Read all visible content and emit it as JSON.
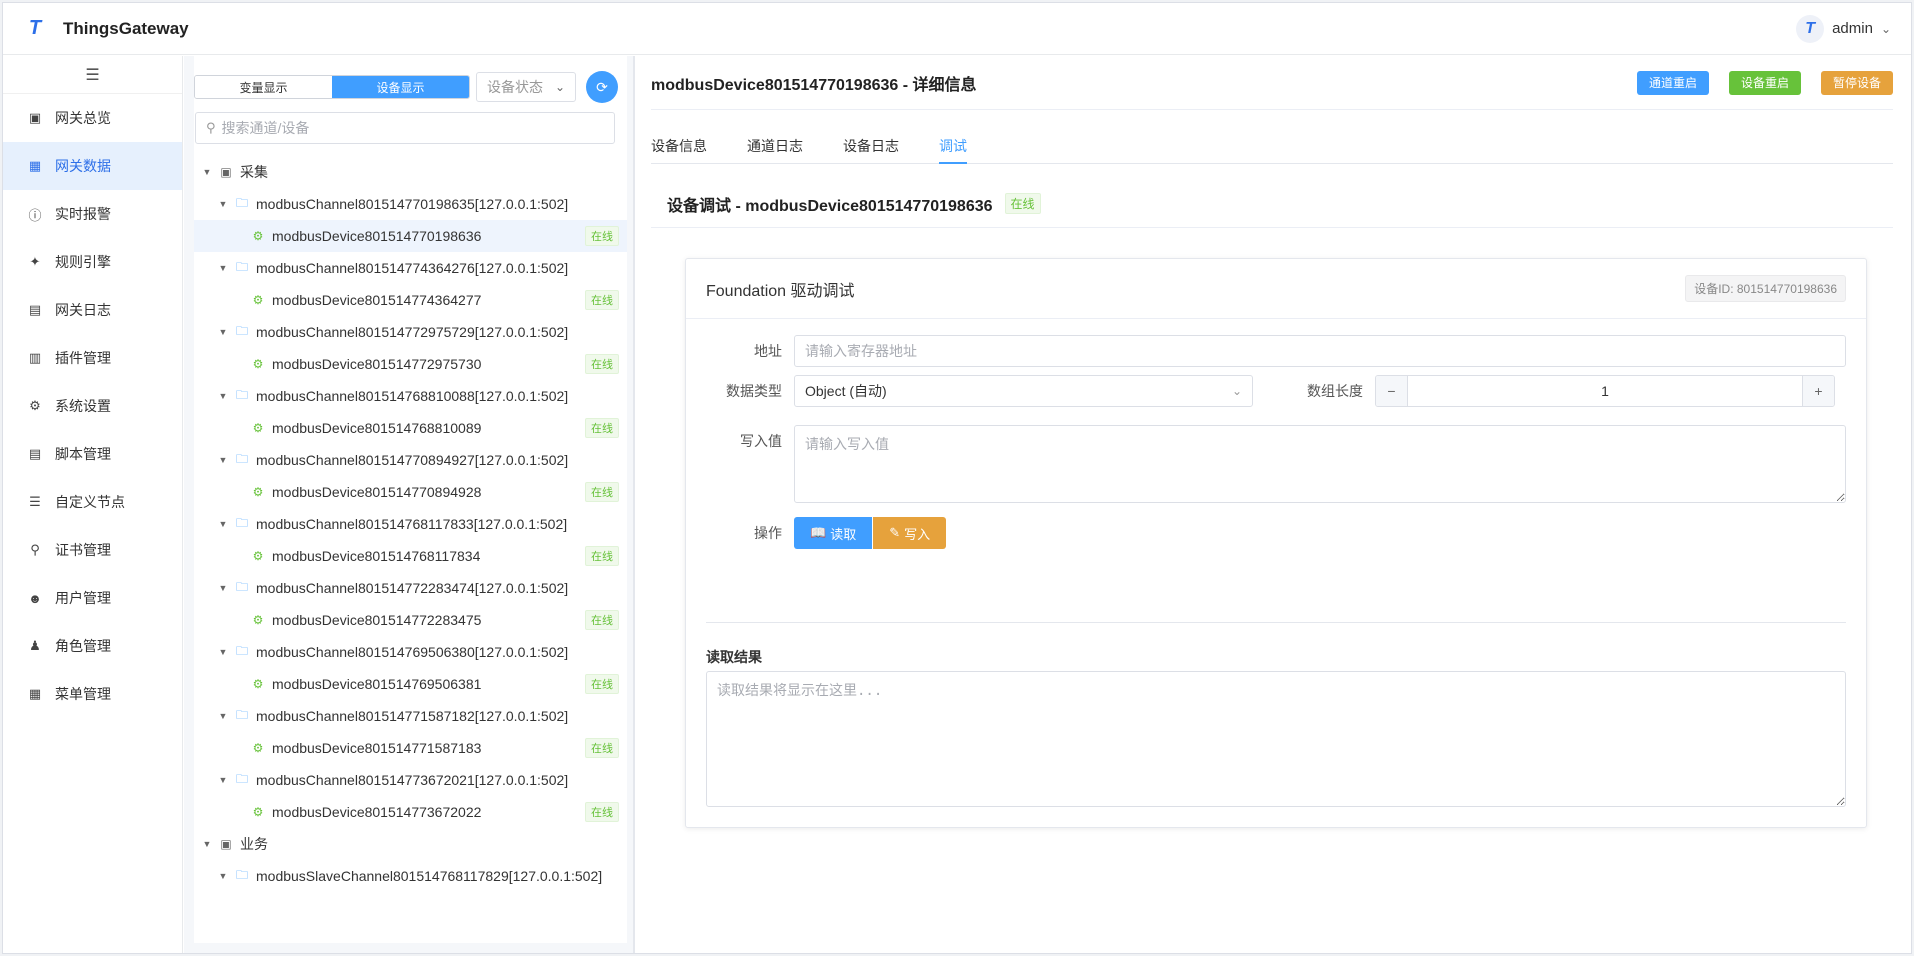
{
  "header": {
    "logo_letter": "T",
    "brand": "ThingsGateway",
    "avatar_letter": "T",
    "user": "admin"
  },
  "sidebar": {
    "items": [
      {
        "label": "网关总览",
        "icon": "monitor-icon"
      },
      {
        "label": "网关数据",
        "icon": "chart-icon"
      },
      {
        "label": "实时报警",
        "icon": "alert-icon"
      },
      {
        "label": "规则引擎",
        "icon": "share-icon"
      },
      {
        "label": "网关日志",
        "icon": "doc-icon"
      },
      {
        "label": "插件管理",
        "icon": "package-icon"
      },
      {
        "label": "系统设置",
        "icon": "gear-icon"
      },
      {
        "label": "脚本管理",
        "icon": "file-icon"
      },
      {
        "label": "自定义节点",
        "icon": "sliders-icon"
      },
      {
        "label": "证书管理",
        "icon": "key-icon"
      },
      {
        "label": "用户管理",
        "icon": "user-icon"
      },
      {
        "label": "角色管理",
        "icon": "person-icon"
      },
      {
        "label": "菜单管理",
        "icon": "grid-icon"
      }
    ],
    "active_index": 1
  },
  "tree_panel": {
    "seg_variable": "变量显示",
    "seg_device": "设备显示",
    "status_select": "设备状态",
    "search_placeholder": "搜索通道/设备",
    "online": "在线",
    "group_collect": "采集",
    "group_business": "业务",
    "channels": [
      {
        "channel": "modbusChannel801514770198635[127.0.0.1:502]",
        "device": "modbusDevice801514770198636"
      },
      {
        "channel": "modbusChannel801514774364276[127.0.0.1:502]",
        "device": "modbusDevice801514774364277"
      },
      {
        "channel": "modbusChannel801514772975729[127.0.0.1:502]",
        "device": "modbusDevice801514772975730"
      },
      {
        "channel": "modbusChannel801514768810088[127.0.0.1:502]",
        "device": "modbusDevice801514768810089"
      },
      {
        "channel": "modbusChannel801514770894927[127.0.0.1:502]",
        "device": "modbusDevice801514770894928"
      },
      {
        "channel": "modbusChannel801514768117833[127.0.0.1:502]",
        "device": "modbusDevice801514768117834"
      },
      {
        "channel": "modbusChannel801514772283474[127.0.0.1:502]",
        "device": "modbusDevice801514772283475"
      },
      {
        "channel": "modbusChannel801514769506380[127.0.0.1:502]",
        "device": "modbusDevice801514769506381"
      },
      {
        "channel": "modbusChannel801514771587182[127.0.0.1:502]",
        "device": "modbusDevice801514771587183"
      },
      {
        "channel": "modbusChannel801514773672021[127.0.0.1:502]",
        "device": "modbusDevice801514773672022"
      }
    ],
    "business_channel": "modbusSlaveChannel801514768117829[127.0.0.1:502]"
  },
  "main": {
    "title": "modbusDevice801514770198636 - 详细信息",
    "btn_channel_restart": "通道重启",
    "btn_device_restart": "设备重启",
    "btn_pause_device": "暂停设备",
    "tabs": [
      "设备信息",
      "通道日志",
      "设备日志",
      "调试"
    ],
    "active_tab": 3,
    "sub_title": "设备调试 - modbusDevice801514770198636",
    "sub_status": "在线",
    "card": {
      "title": "Foundation 驱动调试",
      "device_id": "设备ID: 801514770198636",
      "address_label": "地址",
      "address_placeholder": "请输入寄存器地址",
      "datatype_label": "数据类型",
      "datatype_value": "Object (自动)",
      "arraylen_label": "数组长度",
      "arraylen_value": "1",
      "write_label": "写入值",
      "write_placeholder": "请输入写入值",
      "action_label": "操作",
      "read_btn": "读取",
      "write_btn": "写入",
      "result_label": "读取结果",
      "result_placeholder": "读取结果将显示在这里..."
    }
  },
  "colors": {
    "primary": "#409eff",
    "success": "#67c23a",
    "warning": "#e6a23c",
    "brand": "#2d6fe8"
  }
}
